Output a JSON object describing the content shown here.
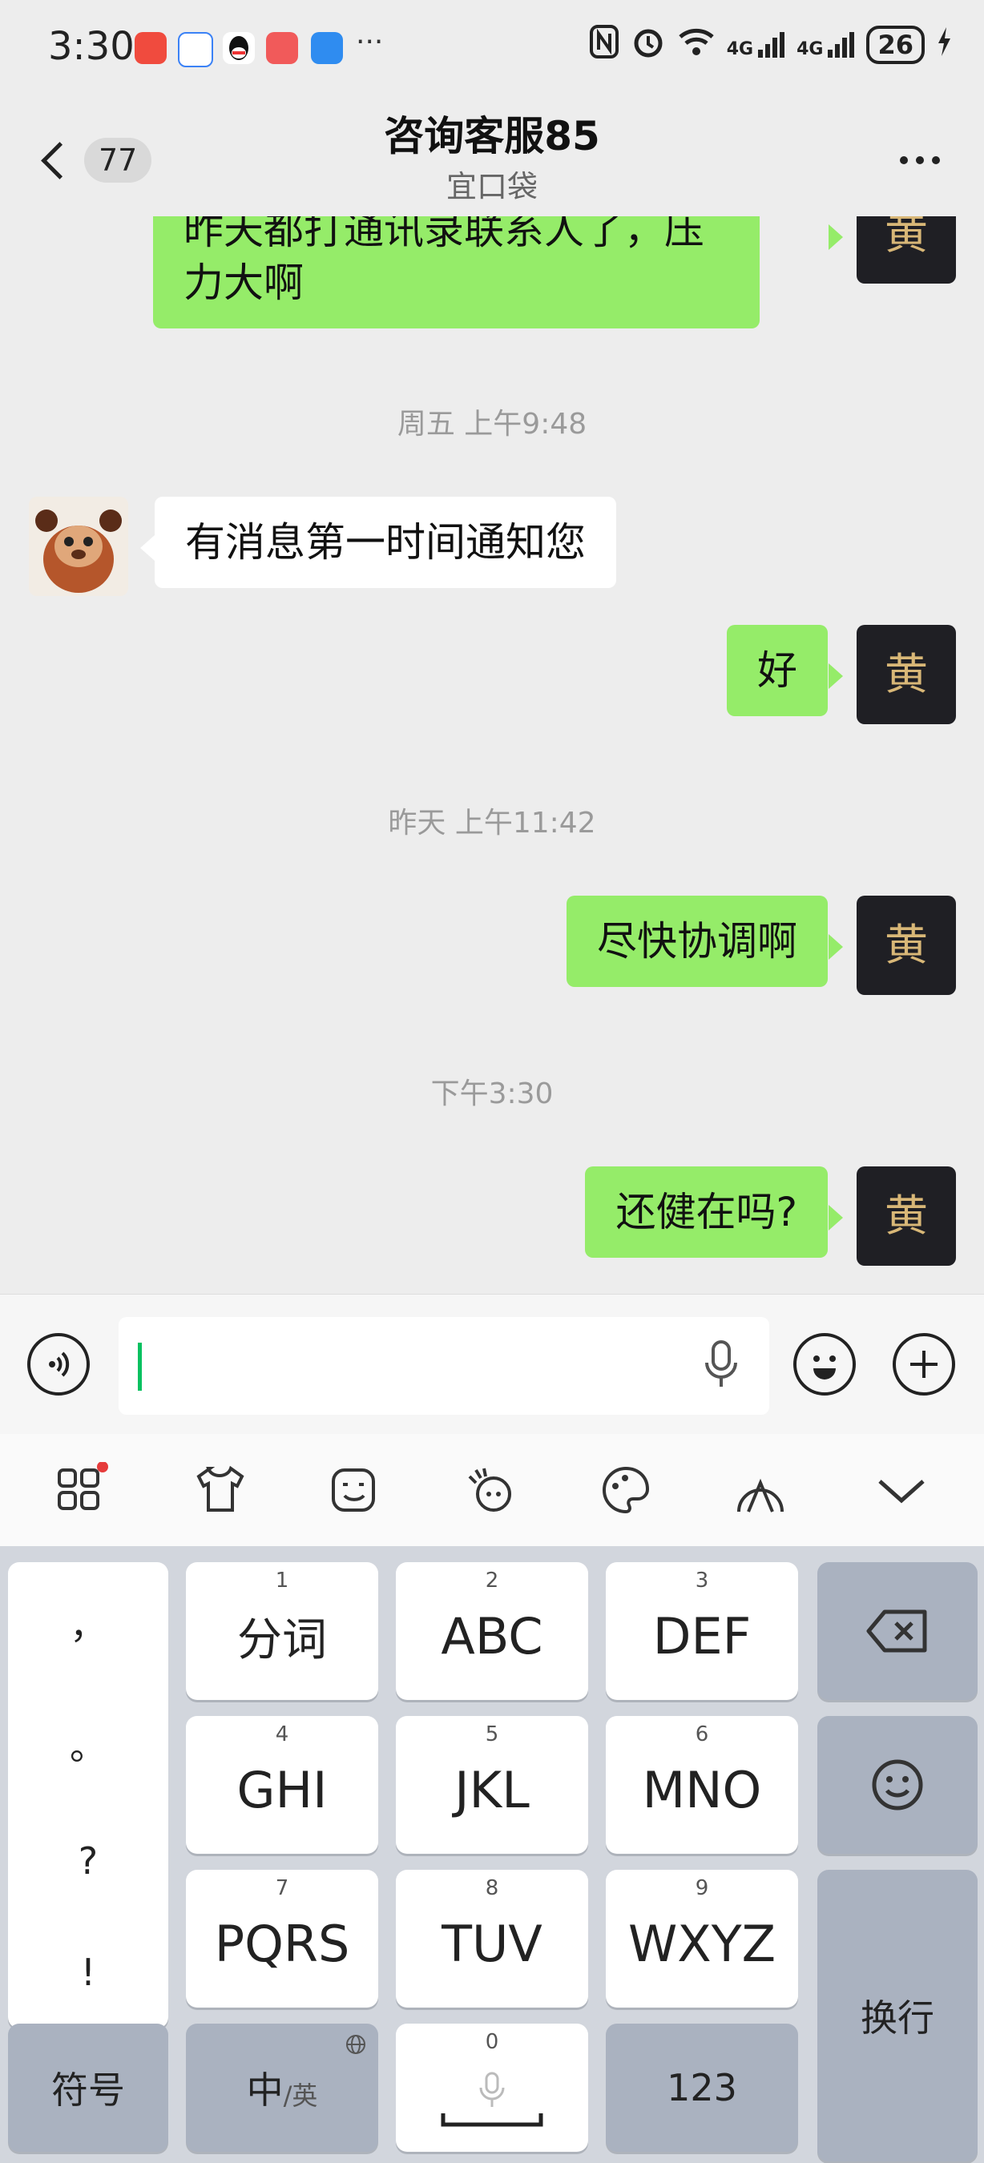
{
  "status_bar": {
    "time": "3:30",
    "overflow": "···",
    "battery": "26",
    "network_1": "4G",
    "network_2": "4G"
  },
  "header": {
    "back_icon": "chevron-left-icon",
    "unread_count": "77",
    "title": "咨询客服85",
    "subtitle": "宜口袋",
    "more_icon": "more-dots-icon"
  },
  "messages": [
    {
      "from": "me",
      "text": "昨天都打通讯录联系人了，压力大啊"
    },
    {
      "type": "time",
      "text": "周五 上午9:48"
    },
    {
      "from": "them",
      "text": "有消息第一时间通知您"
    },
    {
      "from": "me",
      "text": "好"
    },
    {
      "type": "time",
      "text": "昨天 上午11:42"
    },
    {
      "from": "me",
      "text": "尽快协调啊"
    },
    {
      "type": "time",
      "text": "下午3:30"
    },
    {
      "from": "me",
      "text": "还健在吗?"
    }
  ],
  "input_bar": {
    "voice_icon": "voice-wave-icon",
    "mic_icon": "microphone-icon",
    "emoji_icon": "smiley-icon",
    "plus_icon": "plus-circle-icon",
    "value": ""
  },
  "keyboard_toolbar": [
    "apps-grid-icon",
    "skin-icon",
    "emoji-sticker-icon",
    "sticker-icon",
    "palette-icon",
    "handwriting-icon",
    "collapse-chevron-icon"
  ],
  "keyboard": {
    "punct": [
      "，",
      "。",
      "?",
      "!"
    ],
    "keys": [
      {
        "num": "1",
        "label": "分词"
      },
      {
        "num": "2",
        "label": "ABC"
      },
      {
        "num": "3",
        "label": "DEF"
      },
      {
        "num": "4",
        "label": "GHI"
      },
      {
        "num": "5",
        "label": "JKL"
      },
      {
        "num": "6",
        "label": "MNO"
      },
      {
        "num": "7",
        "label": "PQRS"
      },
      {
        "num": "8",
        "label": "TUV"
      },
      {
        "num": "9",
        "label": "WXYZ"
      }
    ],
    "symbols": "符号",
    "lang_main": "中",
    "lang_alt": "/英",
    "space_num": "0",
    "numbers": "123",
    "enter": "换行"
  },
  "colors": {
    "bubble_me": "#95ec69",
    "bubble_them": "#ffffff",
    "chat_bg": "#ededed",
    "caret": "#07c160"
  }
}
